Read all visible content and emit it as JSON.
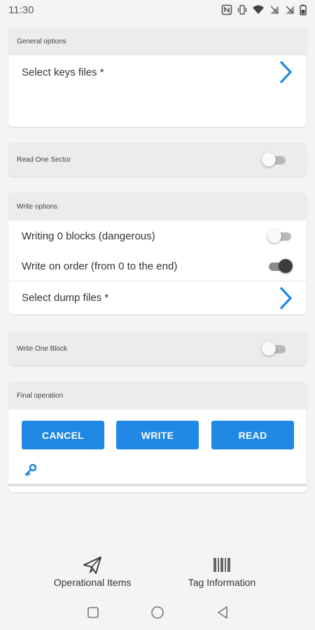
{
  "status_bar": {
    "time": "11:30"
  },
  "general_options": {
    "header": "General options",
    "select_keys_label": "Select keys files *"
  },
  "read_one_sector": {
    "label": "Read One Sector",
    "enabled": false
  },
  "write_options": {
    "header": "Write options",
    "writing_zero_blocks_label": "Writing 0 blocks (dangerous)",
    "writing_zero_blocks_enabled": false,
    "write_on_order_label": "Write on order (from 0 to the end)",
    "write_on_order_enabled": true,
    "select_dump_label": "Select dump files *"
  },
  "write_one_block": {
    "label": "Write One Block",
    "enabled": false
  },
  "final_operation": {
    "header": "Final operation",
    "cancel_label": "CANCEL",
    "write_label": "WRITE",
    "read_label": "READ"
  },
  "bottom_nav": {
    "operational_items_label": "Operational Items",
    "tag_information_label": "Tag Information"
  },
  "colors": {
    "accent": "#1f88e5",
    "header_bg": "#ececec",
    "background": "#f4f4f4"
  },
  "icons": [
    "nfc-icon",
    "vibrate-icon",
    "wifi-icon",
    "signal-icon",
    "battery-icon",
    "chevron-right-icon",
    "key-icon",
    "paper-plane-icon",
    "barcode-icon",
    "square-nav-icon",
    "circle-nav-icon",
    "back-triangle-icon"
  ]
}
